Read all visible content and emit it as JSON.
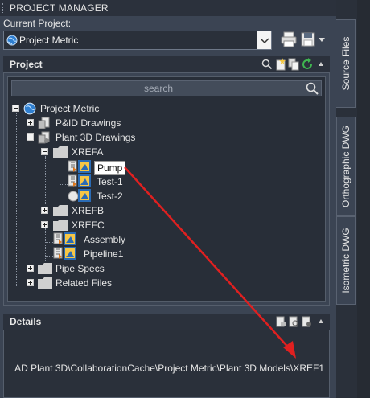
{
  "panel": {
    "title": "PROJECT MANAGER",
    "current_project_label": "Current Project:",
    "current_project_value": "Project Metric"
  },
  "project_section": {
    "header": "Project",
    "search_placeholder": "search",
    "tree": {
      "root": "Project Metric",
      "pid": "P&ID Drawings",
      "plant3d": "Plant 3D Drawings",
      "xrefa": "XREFA",
      "pump": "Pump",
      "test1": "Test-1",
      "test2": "Test-2",
      "xrefb": "XREFB",
      "xrefc": "XREFC",
      "assembly": "Assembly",
      "pipeline1": "Pipeline1",
      "pipespecs": "Pipe Specs",
      "related": "Related Files"
    }
  },
  "details_section": {
    "header": "Details",
    "path": "AD Plant 3D\\CollaborationCache\\Project Metric\\Plant 3D Models\\XREF1"
  },
  "side_tabs": [
    "Source Files",
    "Orthographic DWG",
    "Isometric DWG"
  ],
  "colors": {
    "panel_bg": "#3b4453",
    "header_bg": "#2b313c",
    "tree_bg": "#282e38",
    "arrow": "#e02020"
  },
  "icons": [
    "globe-icon",
    "print-icon",
    "save-icon",
    "search-icon",
    "folder-icon",
    "drawing-icon",
    "refresh-icon"
  ]
}
